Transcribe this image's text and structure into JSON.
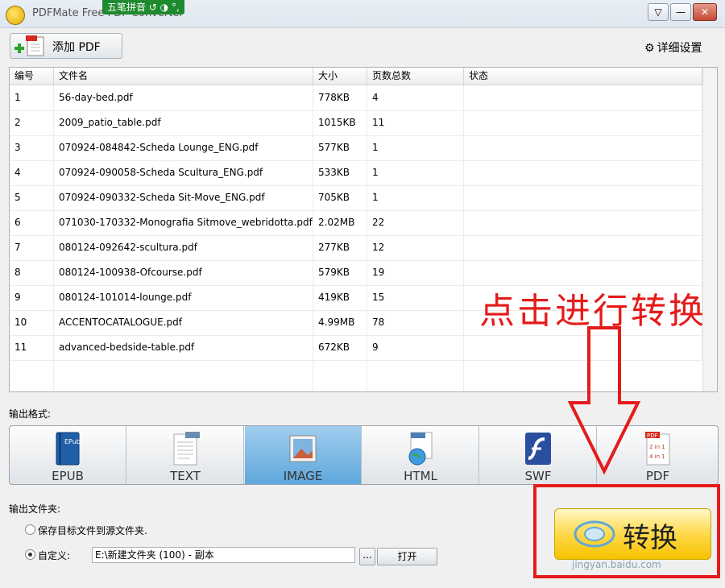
{
  "window": {
    "title": "PDFMate Free PDF Converter",
    "ime_label": "五笔拼音 ↺ ◑ °,",
    "controls": [
      "▽",
      "—",
      "✕"
    ]
  },
  "toolbar": {
    "add_pdf_label": "添加 PDF",
    "settings_label": "详细设置"
  },
  "table": {
    "columns": [
      "编号",
      "文件名",
      "大小",
      "页数总数",
      "状态"
    ],
    "rows": [
      {
        "no": "1",
        "name": "56-day-bed.pdf",
        "size": "778KB",
        "pages": "4",
        "status": ""
      },
      {
        "no": "2",
        "name": "2009_patio_table.pdf",
        "size": "1015KB",
        "pages": "11",
        "status": ""
      },
      {
        "no": "3",
        "name": "070924-084842-Scheda Lounge_ENG.pdf",
        "size": "577KB",
        "pages": "1",
        "status": ""
      },
      {
        "no": "4",
        "name": "070924-090058-Scheda Scultura_ENG.pdf",
        "size": "533KB",
        "pages": "1",
        "status": ""
      },
      {
        "no": "5",
        "name": "070924-090332-Scheda Sit-Move_ENG.pdf",
        "size": "705KB",
        "pages": "1",
        "status": ""
      },
      {
        "no": "6",
        "name": "071030-170332-Monografia Sitmove_webridotta.pdf",
        "size": "2.02MB",
        "pages": "22",
        "status": ""
      },
      {
        "no": "7",
        "name": "080124-092642-scultura.pdf",
        "size": "277KB",
        "pages": "12",
        "status": ""
      },
      {
        "no": "8",
        "name": "080124-100938-Ofcourse.pdf",
        "size": "579KB",
        "pages": "19",
        "status": ""
      },
      {
        "no": "9",
        "name": "080124-101014-lounge.pdf",
        "size": "419KB",
        "pages": "15",
        "status": ""
      },
      {
        "no": "10",
        "name": "ACCENTOCATALOGUE.pdf",
        "size": "4.99MB",
        "pages": "78",
        "status": ""
      },
      {
        "no": "11",
        "name": "advanced-bedside-table.pdf",
        "size": "672KB",
        "pages": "9",
        "status": ""
      }
    ]
  },
  "output_format": {
    "label": "输出格式:",
    "selected": "IMAGE",
    "options": [
      {
        "label": "EPUB",
        "icon": "epub-book-icon"
      },
      {
        "label": "TEXT",
        "icon": "text-doc-icon"
      },
      {
        "label": "IMAGE",
        "icon": "image-icon"
      },
      {
        "label": "HTML",
        "icon": "html-globe-icon"
      },
      {
        "label": "SWF",
        "icon": "flash-icon"
      },
      {
        "label": "PDF",
        "icon": "pdf-pages-icon"
      }
    ],
    "pdf_icon_text": [
      "PDF",
      "2 in 1",
      "4 in 1"
    ]
  },
  "output_folder": {
    "label": "输出文件夹:",
    "option_source": "保存目标文件到源文件夹.",
    "option_custom": "自定义:",
    "custom_selected": true,
    "path_value": "E:\\新建文件夹 (100) - 副本",
    "browse_label": "...",
    "open_label": "打开"
  },
  "convert": {
    "label": "转换"
  },
  "annotation": {
    "text": "点击进行转换",
    "color": "#e51b1b"
  },
  "watermark": "jingyan.baidu.com"
}
